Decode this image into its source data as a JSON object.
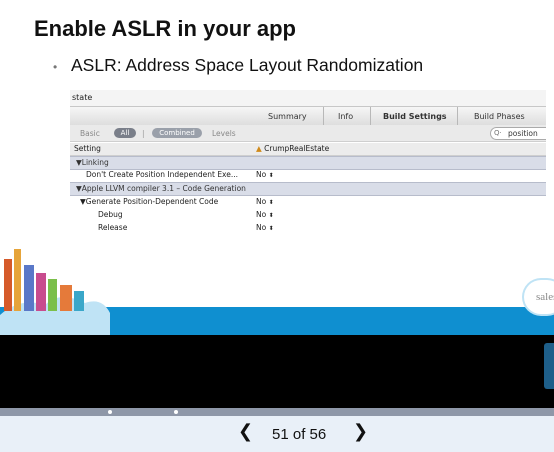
{
  "slide": {
    "title": "Enable ASLR in your app",
    "bullet": "ASLR: Address Space Layout Randomization",
    "bullet_marker": "•"
  },
  "xcode": {
    "window_label": "state",
    "tabs": [
      "Summary",
      "Info",
      "Build Settings",
      "Build Phases"
    ],
    "active_tab": "Build Settings",
    "filters": {
      "basic": "Basic",
      "all": "All",
      "combined": "Combined",
      "levels": "Levels",
      "divider": "|"
    },
    "search_value": "position",
    "header": {
      "setting": "Setting",
      "target": "CrumpRealEstate"
    },
    "rows": [
      {
        "label": "▼Linking",
        "value": ""
      },
      {
        "label": "Don't Create Position Independent Exe...",
        "value": "No"
      },
      {
        "label": "▼Apple LLVM compiler 3.1 – Code Generation",
        "value": ""
      },
      {
        "label": "▼Generate Position-Dependent Code",
        "value": "No"
      },
      {
        "label": "Debug",
        "value": "No"
      },
      {
        "label": "Release",
        "value": "No"
      }
    ],
    "stepper_glyph": "⬍"
  },
  "brand": {
    "partial_logo": "sales"
  },
  "viewer": {
    "page_text": "51 of 56",
    "prev_icon": "chevron-left-icon",
    "next_icon": "chevron-right-icon",
    "prev_glyph": "❮",
    "next_glyph": "❯"
  },
  "colors": {
    "sky": "#0f8fd0",
    "cloud": "#bfe3f5",
    "viewer_bar": "#e9f0f8",
    "progress": "#8e97a8"
  }
}
